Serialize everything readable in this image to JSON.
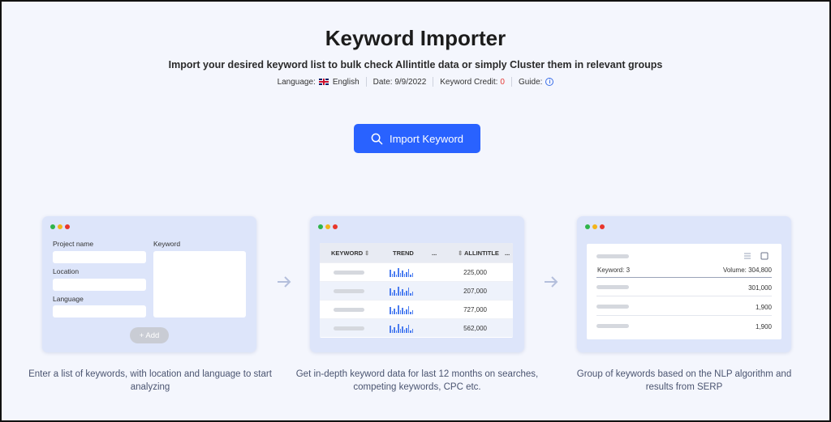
{
  "header": {
    "title": "Keyword Importer",
    "subtitle": "Import your desired keyword list to bulk check Allintitle data or simply Cluster them in relevant groups",
    "language_label": "Language:",
    "language_value": "English",
    "date": "Date: 9/9/2022",
    "credit_label": "Keyword Credit:",
    "credit_value": "0",
    "guide_label": "Guide:",
    "info_glyph": "i"
  },
  "import_button": {
    "label": "Import Keyword",
    "icon": "search-icon"
  },
  "card1": {
    "project_name_label": "Project name",
    "keyword_label": "Keyword",
    "location_label": "Location",
    "language_label": "Language",
    "add_label": "+ Add",
    "caption": "Enter a list of keywords, with location and language to start analyzing"
  },
  "card2": {
    "columns": [
      "KEYWORD",
      "TREND",
      "...",
      "ALLINTITLE",
      "..."
    ],
    "sort_glyph": "⇕",
    "values": [
      "225,000",
      "207,000",
      "727,000",
      "562,000"
    ],
    "caption": "Get in-depth keyword data for last 12 months on searches, competing keywords, CPC etc."
  },
  "card3": {
    "keyword_count": "Keyword: 3",
    "volume": "Volume: 304,800",
    "values": [
      "301,000",
      "1,900",
      "1,900"
    ],
    "caption": "Group of keywords based on the NLP algorithm and results from SERP"
  },
  "colors": {
    "accent": "#2962ff",
    "credit": "#e53935",
    "trend": "#4a7cf0"
  }
}
